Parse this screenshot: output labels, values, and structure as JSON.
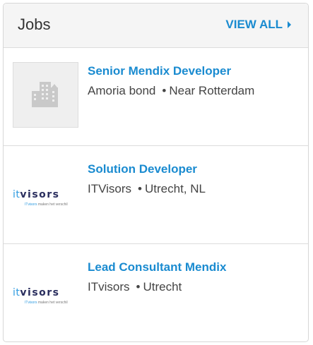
{
  "header": {
    "title": "Jobs",
    "view_all": "VIEW ALL"
  },
  "jobs": [
    {
      "title": "Senior Mendix Developer",
      "company": "Amoria bond",
      "location": "Near Rotterdam",
      "logo": "building-icon"
    },
    {
      "title": "Solution Developer",
      "company": "ITVisors",
      "location": "Utrecht, NL",
      "logo": "itvisors-logo"
    },
    {
      "title": "Lead Consultant Mendix",
      "company": "ITvisors",
      "location": "Utrecht",
      "logo": "itvisors-logo"
    }
  ],
  "logo": {
    "prefix": "it",
    "word": "visors",
    "tag_highlight": "ITvisors",
    "tag_rest": " maken het verschil"
  },
  "separator": "•",
  "colors": {
    "accent": "#1a8bd0",
    "text": "#444444",
    "header_bg": "#f5f5f5"
  }
}
